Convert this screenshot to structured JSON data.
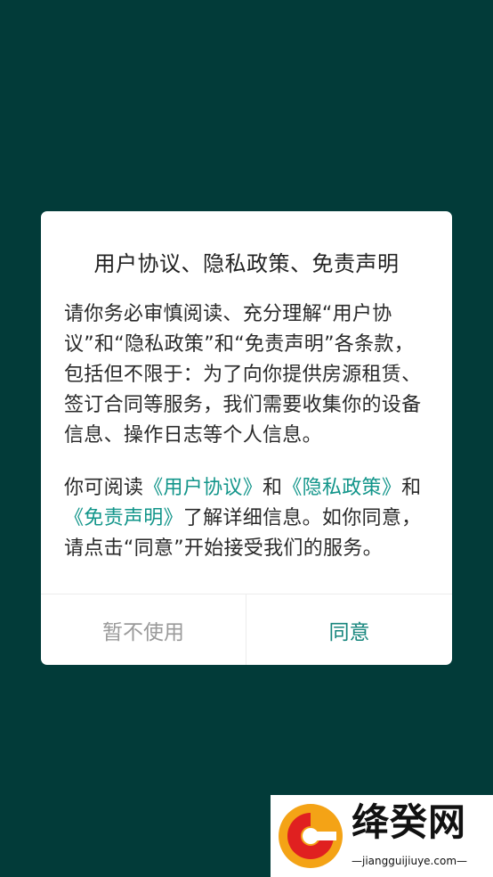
{
  "dialog": {
    "title": "用户协议、隐私政策、免责声明",
    "paragraph1": "请你务必审慎阅读、充分理解“用户协议”和“隐私政策”和“免责声明”各条款，包括但不限于：为了向你提供房源租赁、签订合同等服务，我们需要收集你的设备信息、操作日志等个人信息。",
    "paragraph2": {
      "lead": "你可阅读",
      "link_user_agreement": "《用户协议》",
      "and1": "和",
      "link_privacy_policy": "《隐私政策》",
      "and2": "和",
      "link_disclaimer": "《免责声明》",
      "tail": "了解详细信息。如你同意，请点击“同意”开始接受我们的服务。"
    },
    "buttons": {
      "decline": "暂不使用",
      "agree": "同意"
    }
  },
  "colors": {
    "background": "#023b39",
    "link": "#12958a",
    "agree": "#15857c",
    "decline": "#9a9a9a"
  },
  "watermark": {
    "logo_icon": "g-logo-icon",
    "name": "绛癸网",
    "url": "jiangguijiuye.com"
  }
}
